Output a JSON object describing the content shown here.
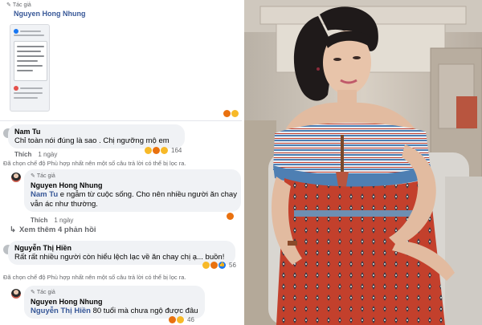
{
  "post": {
    "author_tag": "Tác giả",
    "author_name": "Nguyen Hong Nhung"
  },
  "comments": [
    {
      "name": "Nam Tu",
      "text": "Chỉ toàn nói đúng là sao . Chị ngưỡng mộ em",
      "like_label": "Thích",
      "time": "1 ngày",
      "reaction_count": "164",
      "filter_note": "Đã chọn chế độ Phù hợp nhất nên một số câu trả lời có thể bị lọc ra."
    },
    {
      "author_tag": "Tác giả",
      "name": "Nguyen Hong Nhung",
      "mention": "Nam Tu",
      "text_line1": " e ngẫm từ cuộc sống. Cho nên nhiều người ăn chay",
      "text_line2": "vẫn ác như thường.",
      "like_label": "Thích",
      "time": "1 ngày"
    },
    {
      "more_replies": "Xem thêm 4 phản hồi"
    },
    {
      "name": "Nguyễn Thị Hiền",
      "text": "Rất rất nhiều người còn hiểu lệch lạc về ăn chay chị ạ... buồn!",
      "reaction_count": "56",
      "filter_note": "Đã chọn chế độ Phù hợp nhất nên một số câu trả lời có thể bị lọc ra."
    },
    {
      "author_tag": "Tác giả",
      "name": "Nguyen Hong Nhung",
      "mention": "Nguyễn Thị Hiền",
      "text": " 80 tuổi mà chưa ngộ được đâu",
      "reaction_count": "46"
    }
  ],
  "colors": {
    "link_blue": "#385898",
    "meta_gray": "#65676b",
    "bubble_bg": "#f0f2f5",
    "dress_red": "#c2452f",
    "lace_white": "#e9edf2",
    "wall": "#d4ccc1"
  },
  "icons": [
    "pen-icon",
    "reply-arrow-icon",
    "haha-reaction-icon",
    "angry-reaction-icon",
    "like-reaction-icon"
  ]
}
